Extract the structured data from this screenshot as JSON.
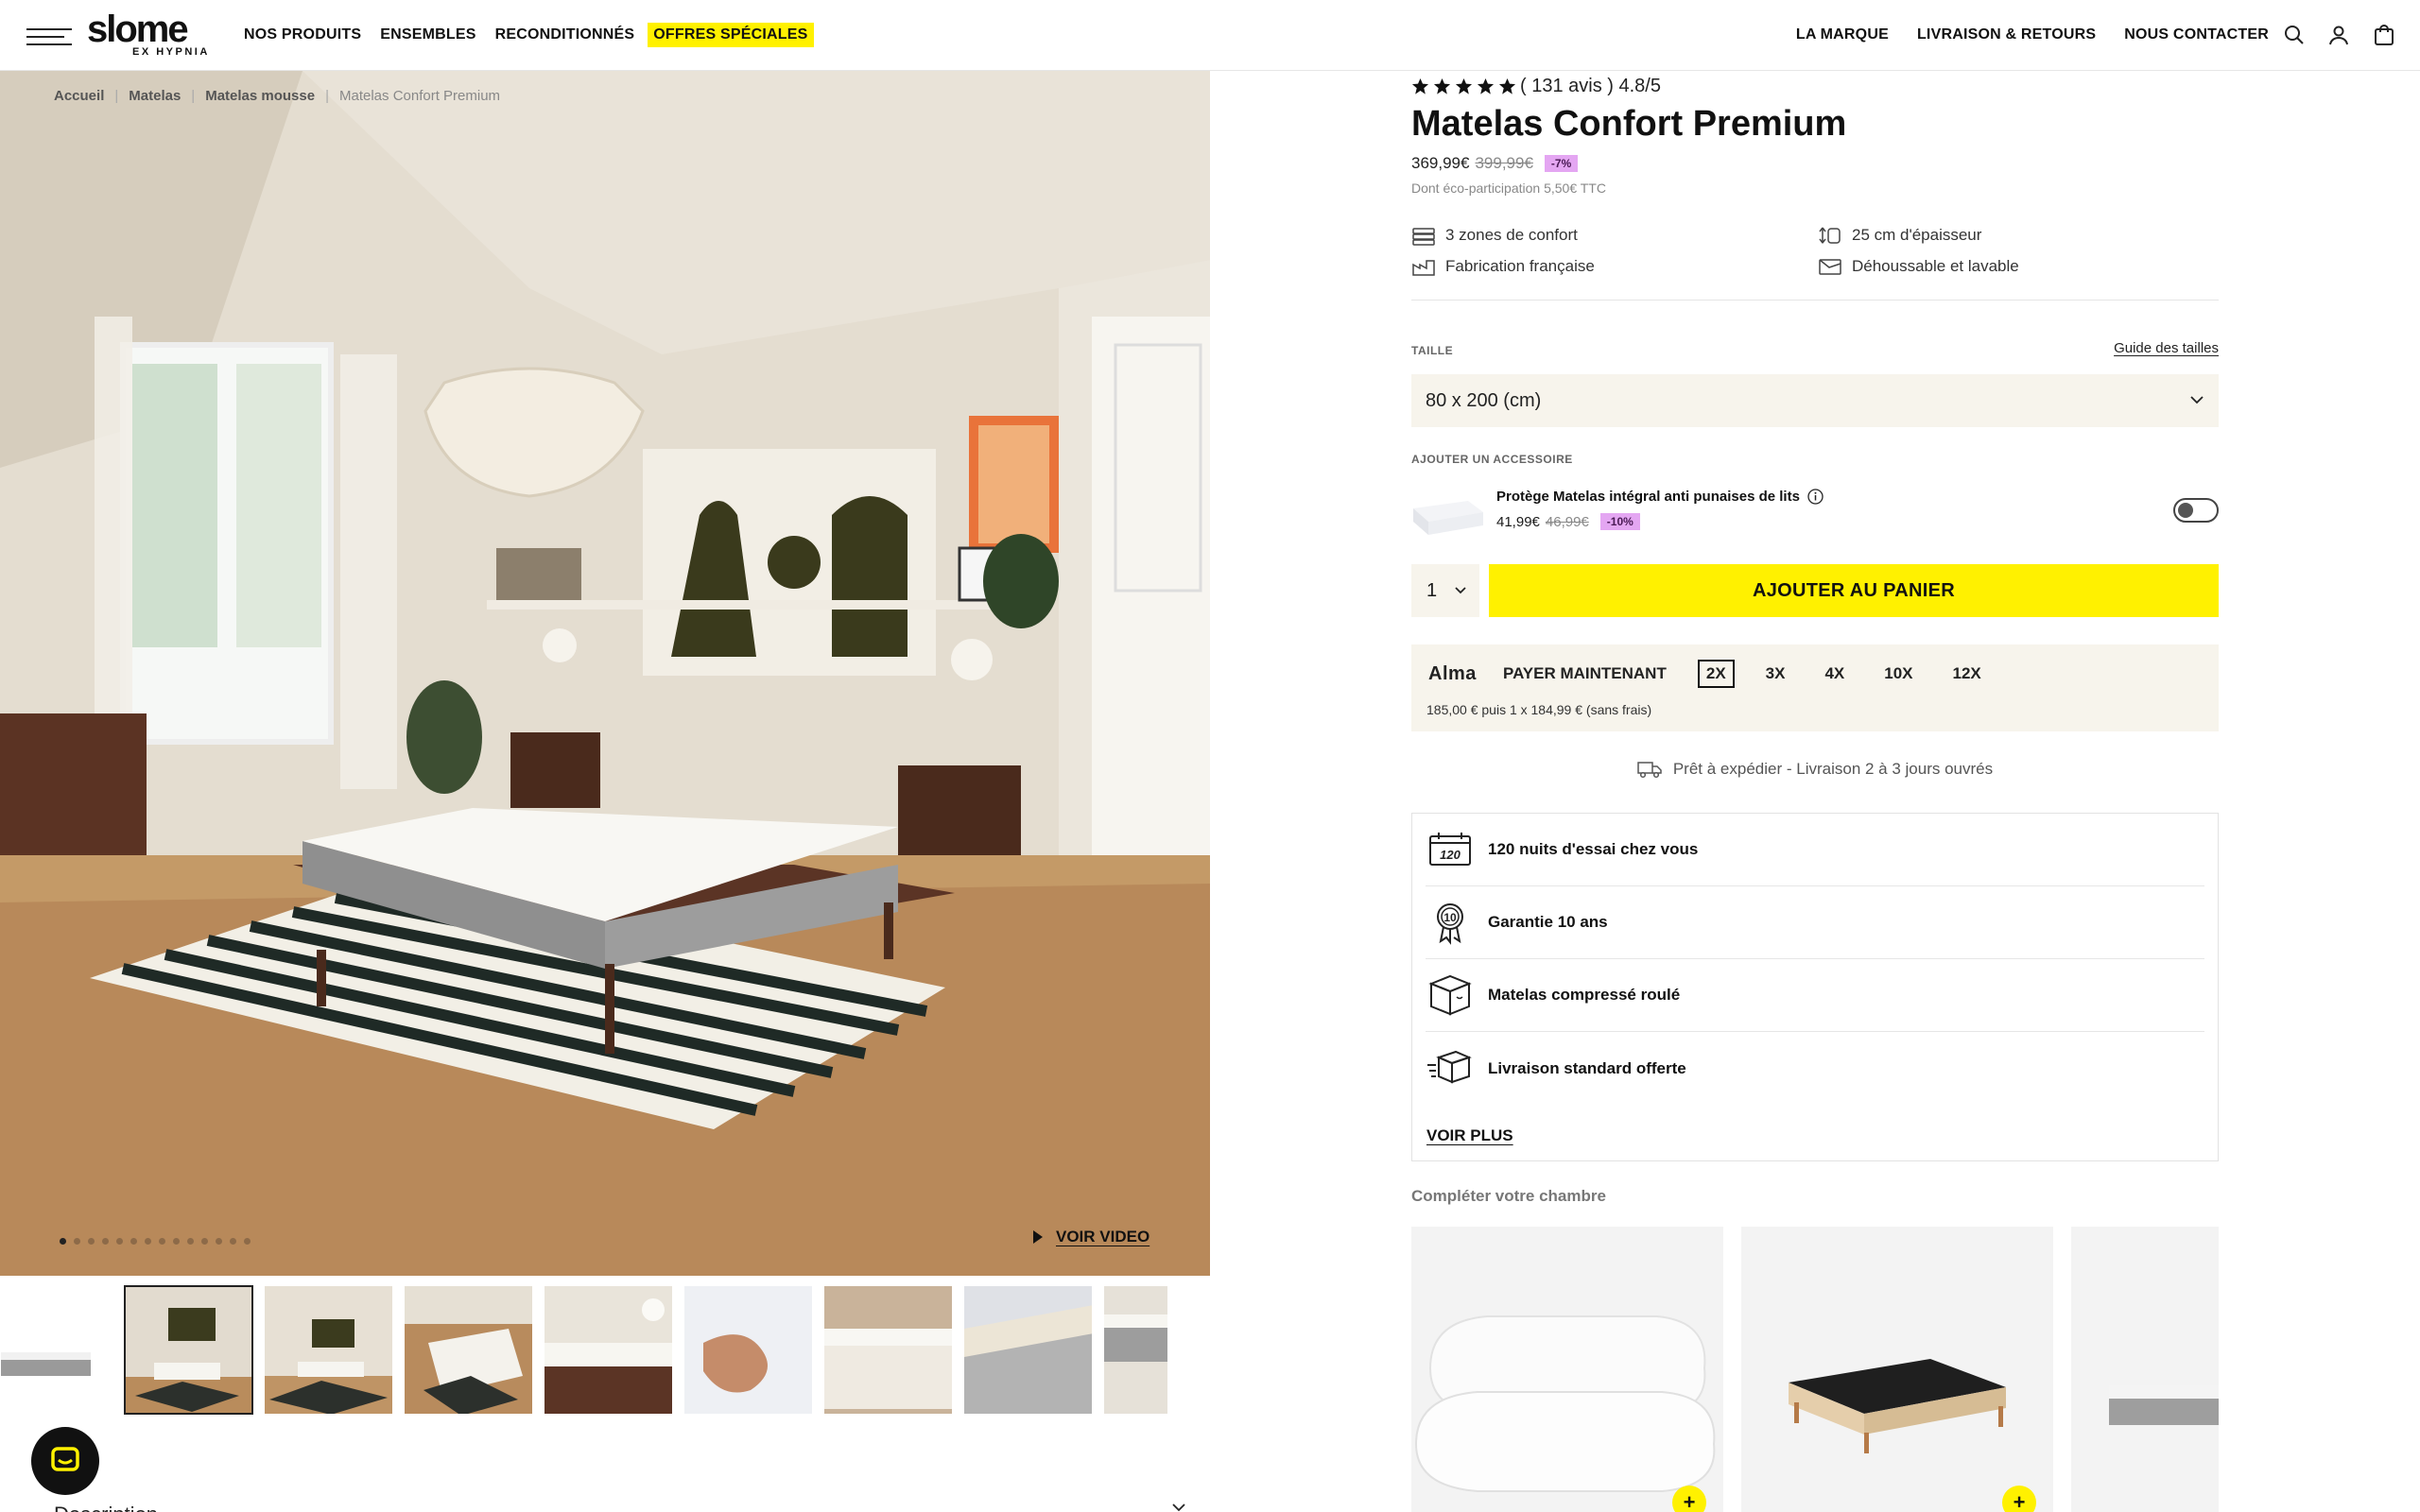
{
  "header": {
    "logo_main": "slome",
    "logo_sub": "EX HYPNIA",
    "nav_left": [
      "NOS PRODUITS",
      "ENSEMBLES",
      "RECONDITIONNÉS",
      "OFFRES SPÉCIALES"
    ],
    "nav_right": [
      "LA MARQUE",
      "LIVRAISON & RETOURS",
      "NOUS CONTACTER"
    ],
    "icons": [
      "search-icon",
      "account-icon",
      "cart-icon"
    ]
  },
  "breadcrumb": [
    "Accueil",
    "Matelas",
    "Matelas mousse",
    "Matelas Confort Premium"
  ],
  "gallery": {
    "video_label": "VOIR VIDEO",
    "dot_count": 14,
    "active_dot": 1,
    "thumb_count": 9,
    "active_thumb": 1
  },
  "product": {
    "rating_text": "( 131 avis ) 4.8/5",
    "stars": 5,
    "title": "Matelas Confort Premium",
    "price": "369,99€",
    "old_price": "399,99€",
    "discount": "-7%",
    "eco": "Dont éco-participation 5,50€ TTC",
    "features": [
      {
        "icon": "layers-icon",
        "label": "3 zones de confort"
      },
      {
        "icon": "thickness-icon",
        "label": "25 cm d'épaisseur"
      },
      {
        "icon": "factory-icon",
        "label": "Fabrication française"
      },
      {
        "icon": "washable-cover-icon",
        "label": "Déhoussable et lavable"
      }
    ],
    "size_label": "TAILLE",
    "size_guide": "Guide des tailles",
    "size_value": "80 x 200 (cm)",
    "accessory_label": "AJOUTER UN ACCESSOIRE",
    "accessory": {
      "name": "Protège Matelas intégral anti punaises de lits",
      "price": "41,99€",
      "old_price": "46,99€",
      "discount": "-10%",
      "enabled": false
    },
    "quantity": "1",
    "add_to_cart": "AJOUTER AU PANIER",
    "alma": {
      "logo": "Alma",
      "options": [
        "PAYER MAINTENANT",
        "2X",
        "3X",
        "4X",
        "10X",
        "12X"
      ],
      "selected": "2X",
      "note": "185,00 € puis 1 x 184,99 € (sans frais)"
    },
    "shipping": "Prêt à expédier - Livraison 2 à 3 jours ouvrés",
    "reassurance": [
      {
        "icon": "trial-120-icon",
        "label": "120 nuits d'essai chez vous"
      },
      {
        "icon": "warranty-10-icon",
        "label": "Garantie 10 ans"
      },
      {
        "icon": "box-icon",
        "label": "Matelas compressé roulé"
      },
      {
        "icon": "delivery-box-icon",
        "label": "Livraison standard offerte"
      }
    ],
    "voir_plus": "VOIR PLUS",
    "complete_title": "Compléter votre chambre"
  },
  "footer_peek": {
    "description_label": "Description"
  },
  "colors": {
    "accent_yellow": "#fff100",
    "badge_pink": "#e4a6f2",
    "panel_beige": "#f7f4ec"
  }
}
